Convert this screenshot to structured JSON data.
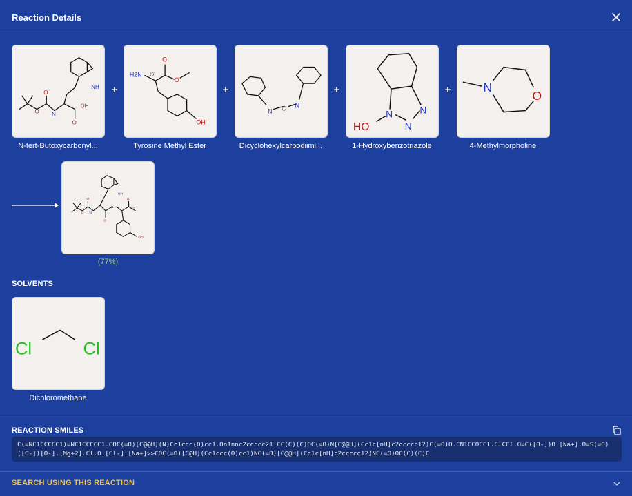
{
  "header": {
    "title": "Reaction Details"
  },
  "reactants": [
    {
      "name": "N-tert-Butoxycarbonyl..."
    },
    {
      "name": "Tyrosine Methyl Ester"
    },
    {
      "name": "Dicyclohexylcarbodiimi..."
    },
    {
      "name": "1-Hydroxybenzotriazole"
    },
    {
      "name": "4-Methylmorpholine"
    }
  ],
  "operators": {
    "plus": "+"
  },
  "product": {
    "yield": "(77%)"
  },
  "solvents": {
    "title": "SOLVENTS",
    "items": [
      {
        "name": "Dichloromethane"
      }
    ]
  },
  "smiles": {
    "title": "REACTION SMILES",
    "value": "C(=NC1CCCCC1)=NC1CCCCC1.COC(=O)[C@@H](N)Cc1ccc(O)cc1.On1nnc2ccccc21.CC(C)(C)OC(=O)N[C@@H](Cc1c[nH]c2ccccc12)C(=O)O.CN1CCOCC1.ClCCl.O=C([O-])O.[Na+].O=S(=O)([O-])[O-].[Mg+2].Cl.O.[Cl-].[Na+]>>COC(=O)[C@H](Cc1ccc(O)cc1)NC(=O)[C@@H](Cc1c[nH]c2ccccc12)NC(=O)OC(C)(C)C"
  },
  "search": {
    "label": "SEARCH USING THIS REACTION"
  },
  "colors": {
    "background": "#1d3f9e",
    "accent": "#f0c040",
    "yield": "#9ccc8a",
    "card": "#f3f0ee"
  },
  "icons": {
    "close": "close-icon",
    "copy": "copy-icon",
    "chevron": "chevron-down-icon",
    "arrow": "reaction-arrow-icon"
  }
}
